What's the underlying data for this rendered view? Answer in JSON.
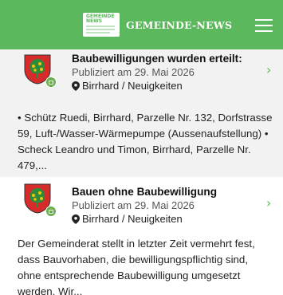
{
  "header": {
    "logo_small_text": "GEMEINDE NEWS",
    "title": "GEMEINDE-NEWS",
    "brand_color": "#5cb85c"
  },
  "articles": [
    {
      "title": "Baubewilligungen wurden erteilt:",
      "published": "Publiziert am 29. Mai 2026",
      "location": "Birrhard / Neuigkeiten",
      "excerpt": "• Schütz Ruedi, Birrhard, Parzelle Nr. 132, Dorf­strasse 59, Luft-/Wasser-Wärmepumpe (Aussen­aufstellung)  • Scheck Leandro und Timon, Birr­hard, Parzelle Nr. 479,..."
    },
    {
      "title": "Bauen ohne Baubewilligung",
      "published": "Publiziert am 29. Mai 2026",
      "location": "Birrhard / Neuigkeiten",
      "excerpt": "Der Gemeinderat stellt in letzter Zeit vermehrt fest, dass Bauvorhaben, die bewilligungspflichtig sind, ohne entsprechende Baubewilligung umge­setzt werden.  Wir..."
    }
  ],
  "icons": {
    "menu": "hamburger-menu-icon",
    "location": "map-pin-icon",
    "chevron": "chevron-right-icon",
    "crest": "municipality-crest-icon",
    "badge": "news-badge-icon"
  },
  "chevron_glyph": "›"
}
